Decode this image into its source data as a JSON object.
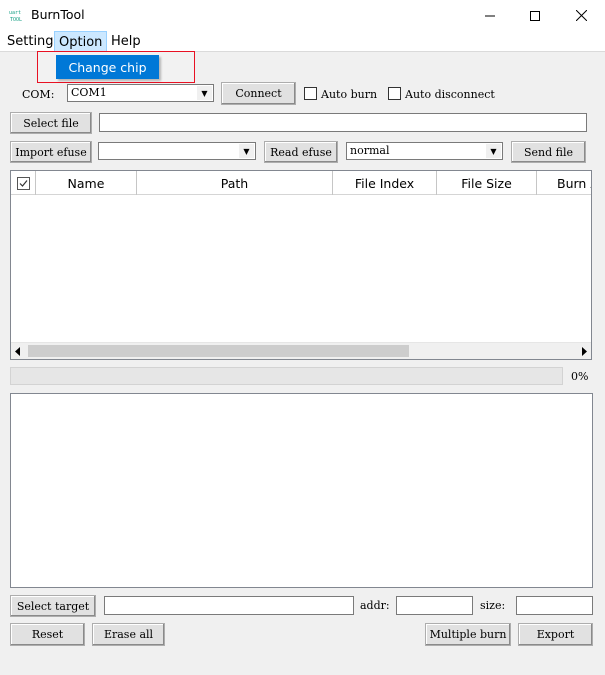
{
  "window": {
    "title": "BurnTool",
    "icon": "burntool-app-icon",
    "controls": [
      "minimize-icon",
      "maximize-icon",
      "close-icon"
    ]
  },
  "menubar": {
    "setting": "Setting",
    "option": "Option",
    "help": "Help"
  },
  "option_menu": {
    "change_chip": "Change chip"
  },
  "connection": {
    "com_label": "COM:",
    "com_value": "COM1",
    "connect_label": "Connect",
    "auto_burn_label": "Auto burn",
    "auto_burn_checked": false,
    "auto_disconnect_label": "Auto disconnect",
    "auto_disconnect_checked": false
  },
  "file_row": {
    "select_file_label": "Select file",
    "file_path": ""
  },
  "efuse_row": {
    "import_efuse_label": "Import efuse",
    "efuse_value": "",
    "read_efuse_label": "Read efuse",
    "mode_value": "normal",
    "send_file_label": "Send file"
  },
  "table": {
    "columns": [
      "Name",
      "Path",
      "File Index",
      "File Size",
      "Burn A"
    ],
    "rows": []
  },
  "progress": {
    "percent": 0,
    "text": "0%"
  },
  "log": {
    "text": ""
  },
  "target_row": {
    "select_target_label": "Select target",
    "target_value": "",
    "addr_label": "addr:",
    "addr_value": "",
    "size_label": "size:",
    "size_value": ""
  },
  "bottom_buttons": {
    "reset": "Reset",
    "erase_all": "Erase all",
    "multiple_burn": "Multiple burn",
    "export": "Export"
  },
  "colors": {
    "accent": "#0078d7",
    "highlight_border": "#e81123",
    "window_bg": "#f0f0f0"
  }
}
